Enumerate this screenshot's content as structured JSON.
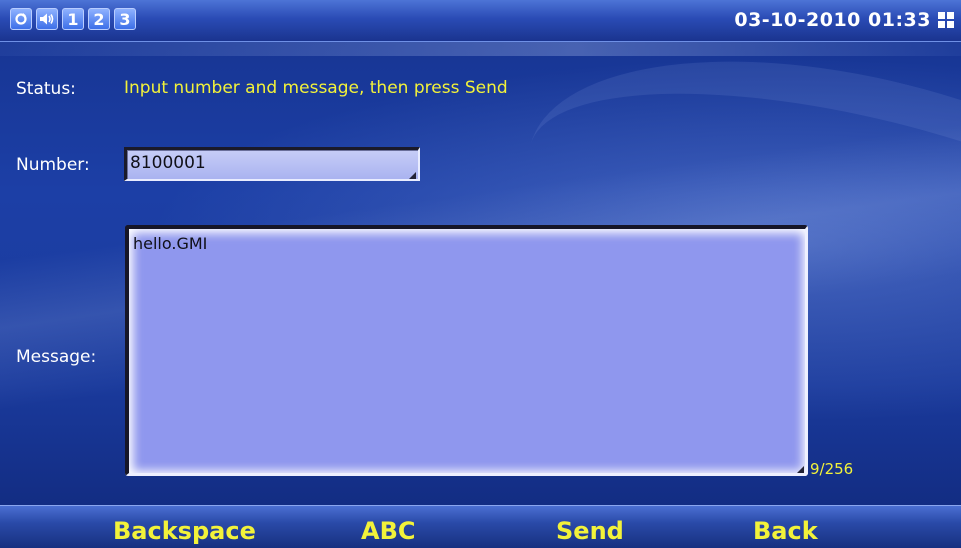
{
  "statusbar": {
    "icons": [
      {
        "name": "refresh-icon"
      },
      {
        "name": "volume-icon"
      },
      {
        "name": "line-1-icon",
        "label": "1"
      },
      {
        "name": "line-2-icon",
        "label": "2"
      },
      {
        "name": "line-3-icon",
        "label": "3"
      }
    ],
    "datetime": "03-10-2010 01:33",
    "signal_icon": "network-icon"
  },
  "form": {
    "status_label": "Status:",
    "status_text": "Input number and message, then press Send",
    "number_label": "Number:",
    "number_value": "8100001",
    "message_label": "Message:",
    "message_value": "hello.GMI",
    "char_count": "9/256"
  },
  "softkeys": {
    "backspace": "Backspace",
    "abc": "ABC",
    "send": "Send",
    "back": "Back"
  },
  "colors": {
    "accent_text": "#f2f23a",
    "background": "#1c3fa6",
    "message_field": "#8f97ee"
  }
}
